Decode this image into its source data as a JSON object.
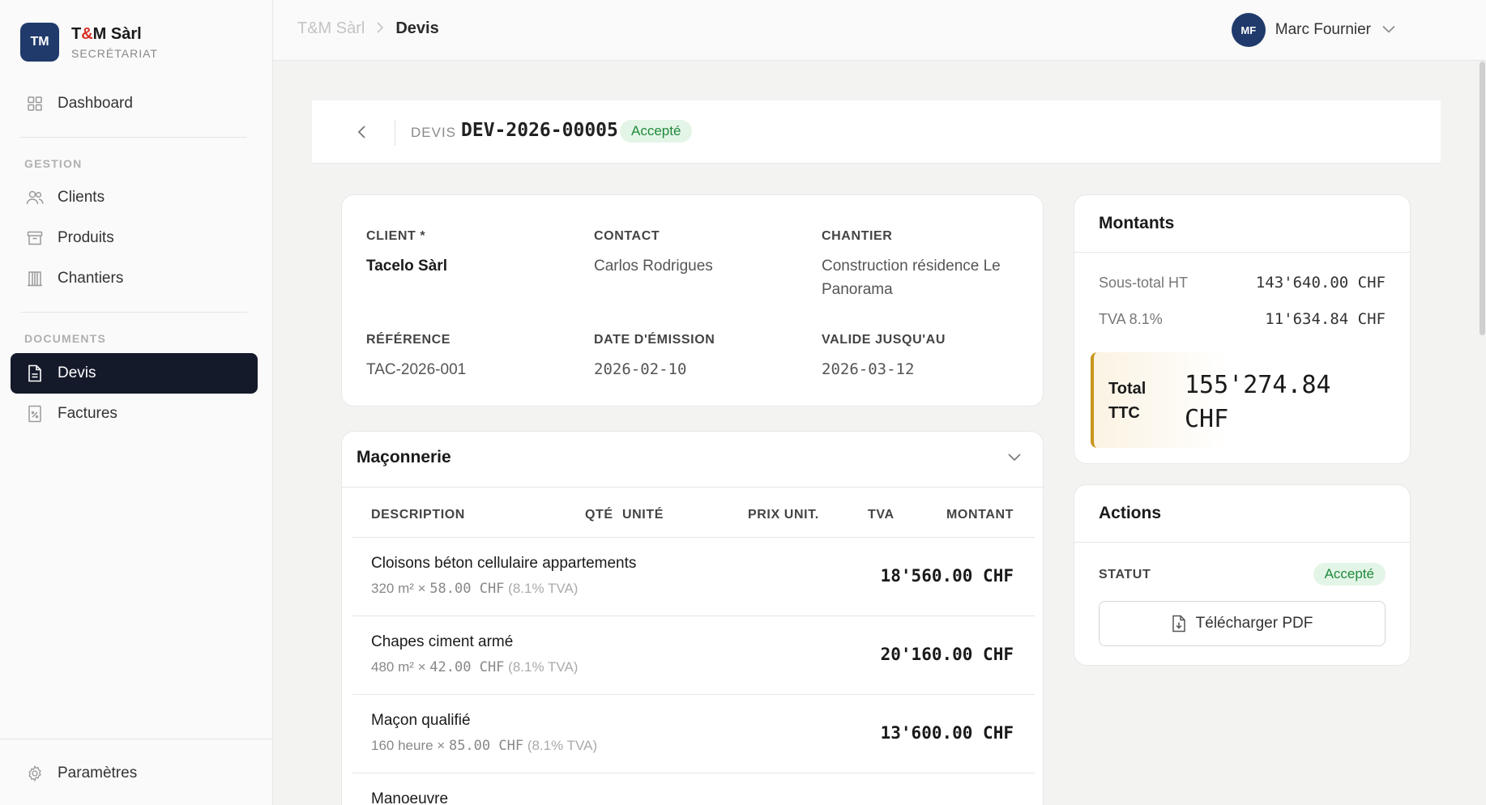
{
  "brand": {
    "logo": "TM",
    "name_a": "T",
    "name_amp": "&",
    "name_b": "M Sàrl",
    "subtitle": "SECRÉTARIAT"
  },
  "sidebar": {
    "dashboard": "Dashboard",
    "group_gestion": "GESTION",
    "clients": "Clients",
    "produits": "Produits",
    "chantiers": "Chantiers",
    "group_documents": "DOCUMENTS",
    "devis": "Devis",
    "factures": "Factures",
    "parametres": "Paramètres"
  },
  "topbar": {
    "crumb_root": "T&M Sàrl",
    "crumb_current": "Devis",
    "user_initials": "MF",
    "user_name": "Marc Fournier"
  },
  "header": {
    "label": "DEVIS",
    "number": "DEV-2026-00005",
    "status": "Accepté"
  },
  "info": {
    "client_label": "CLIENT *",
    "client_value": "Tacelo Sàrl",
    "contact_label": "CONTACT",
    "contact_value": "Carlos Rodrigues",
    "chantier_label": "CHANTIER",
    "chantier_value": "Construction résidence Le Panorama",
    "reference_label": "RÉFÉRENCE",
    "reference_value": "TAC-2026-001",
    "date_label": "DATE D'ÉMISSION",
    "date_value": "2026-02-10",
    "valid_label": "VALIDE JUSQU'AU",
    "valid_value": "2026-03-12"
  },
  "section": {
    "title": "Maçonnerie",
    "columns": {
      "description": "DESCRIPTION",
      "qte": "QTÉ",
      "unite": "UNITÉ",
      "prix": "PRIX UNIT.",
      "tva": "TVA",
      "montant": "MONTANT"
    },
    "lines": [
      {
        "description": "Cloisons béton cellulaire appartements",
        "qty_unit": "320 m² × ",
        "price": "58.00 CHF",
        "tva": "(8.1% TVA)",
        "amount": "18'560.00 CHF"
      },
      {
        "description": "Chapes ciment armé",
        "qty_unit": "480 m² × ",
        "price": "42.00 CHF",
        "tva": "(8.1% TVA)",
        "amount": "20'160.00 CHF"
      },
      {
        "description": "Maçon qualifié",
        "qty_unit": "160 heure × ",
        "price": "85.00 CHF",
        "tva": "(8.1% TVA)",
        "amount": "13'600.00 CHF"
      },
      {
        "description": "Manoeuvre"
      }
    ]
  },
  "amounts": {
    "title": "Montants",
    "subtotal_label": "Sous-total HT",
    "subtotal_value": "143'640.00 CHF",
    "tva_label": "TVA 8.1%",
    "tva_value": "11'634.84 CHF",
    "total_label": "Total TTC",
    "total_value": "155'274.84 CHF"
  },
  "actions": {
    "title": "Actions",
    "statut_label": "STATUT",
    "statut_value": "Accepté",
    "pdf_label": "Télécharger PDF"
  },
  "colors": {
    "brand": "#1f3a6b",
    "active_nav": "#151a2b",
    "success_bg": "#e3f5e7",
    "success_text": "#1f8a3b",
    "total_accent": "#c9951b",
    "brand_amp": "#d93025"
  }
}
